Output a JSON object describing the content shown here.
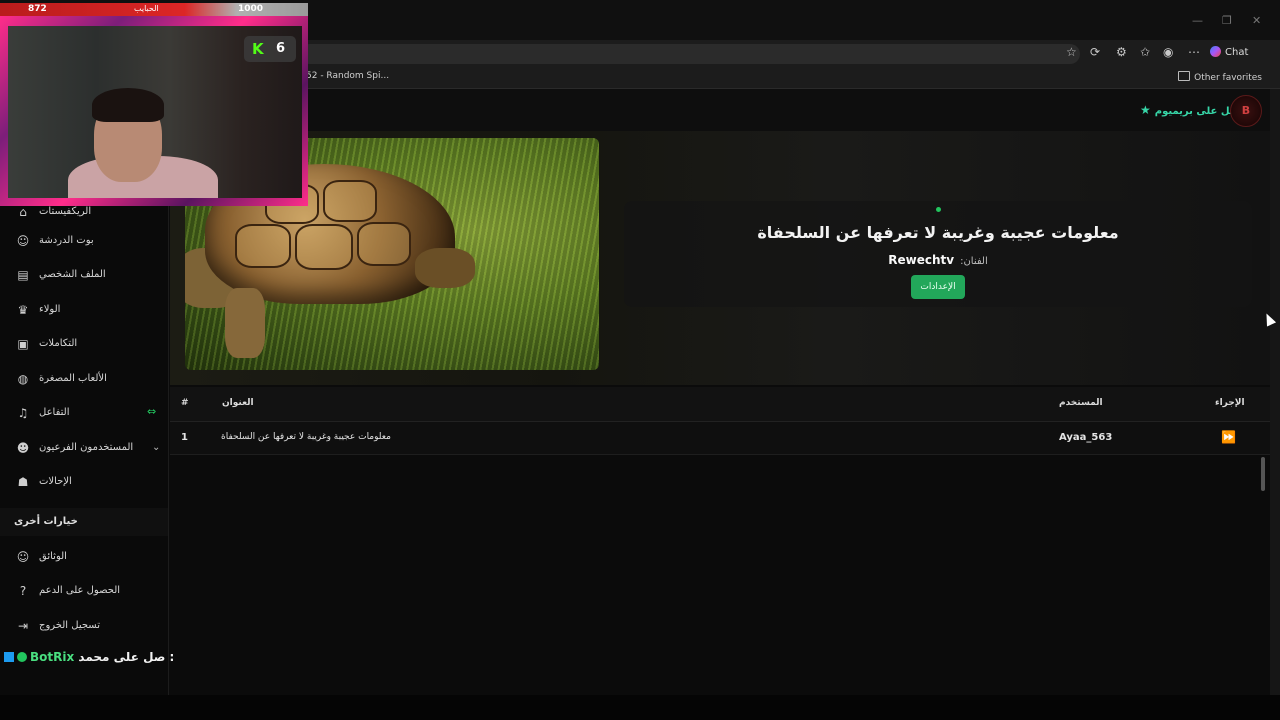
{
  "browser": {
    "tab_label": "52 - Random Spi...",
    "other_favorites": "Other favorites",
    "chat_label": "Chat"
  },
  "header": {
    "premium_label": "احصل على بريميوم",
    "logo_text": "B"
  },
  "sidebar": {
    "items": [
      {
        "label": "الريكفيستات",
        "icon": "home-icon"
      },
      {
        "label": "بوت الدردشة",
        "icon": "robot-icon"
      },
      {
        "label": "الملف الشخصي",
        "icon": "id-card-icon"
      },
      {
        "label": "الولاء",
        "icon": "trophy-icon"
      },
      {
        "label": "التكاملات",
        "icon": "plug-icon"
      },
      {
        "label": "الألعاب المصغرة",
        "icon": "gamepad-icon"
      },
      {
        "label": "التفاعل",
        "icon": "music-icon"
      },
      {
        "label": "المستخدمون الفرعيون",
        "icon": "users-icon"
      },
      {
        "label": "الإحالات",
        "icon": "user-group-icon"
      }
    ],
    "section_label": "خيارات أخرى",
    "other_items": [
      {
        "label": "الوثائق",
        "icon": "robot-icon"
      },
      {
        "label": "الحصول على الدعم",
        "icon": "question-icon"
      },
      {
        "label": "تسجيل الخروج",
        "icon": "logout-icon"
      }
    ]
  },
  "now_playing": {
    "title": "معلومات عجيبة وغريبة لا تعرفها عن السلحفاة",
    "artist_label": ":الفنان",
    "artist": "Rewechtv",
    "settings_button": "الإعدادات"
  },
  "queue": {
    "headers": {
      "index": "#",
      "title": "العنوان",
      "user": "المستخدم",
      "action": "الإجراء"
    },
    "rows": [
      {
        "index": "1",
        "title": "معلومات عجيبة وغريبة لا تعرفها عن السلحفاة",
        "user": "Ayaa_563"
      }
    ]
  },
  "chat_overlay": {
    "text": "صل على محمد :",
    "name": "BotRix"
  },
  "webcam": {
    "left_count": "872",
    "mid_label": "الحبايب",
    "right_count": "1000",
    "k_letter": "K",
    "k_count": "6"
  },
  "colors": {
    "accent_green": "#22a75a",
    "premium_teal": "#37d6a8",
    "kick_green": "#53fc18",
    "frame_pink": "#ff2d8a"
  }
}
